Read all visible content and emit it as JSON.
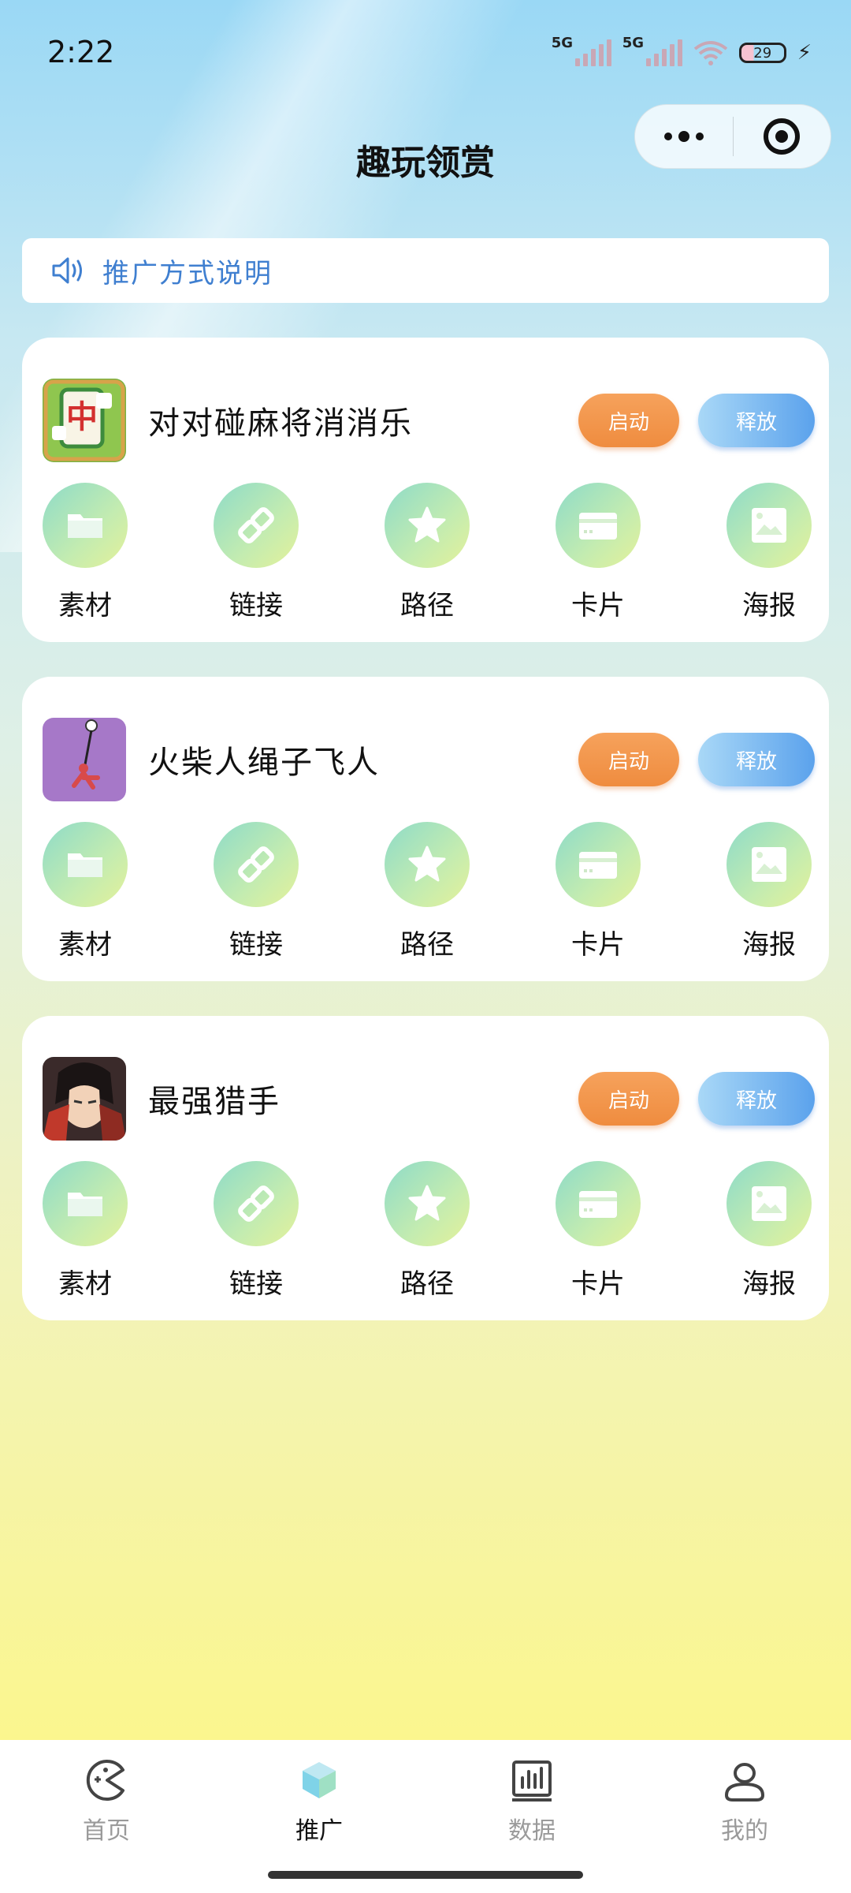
{
  "status_bar": {
    "time": "2:22",
    "signal1_label": "5G",
    "signal2_label": "5G",
    "battery": "29"
  },
  "header": {
    "title": "趣玩领赏"
  },
  "notice": {
    "text": "推广方式说明",
    "icon": "speaker-icon"
  },
  "cards": [
    {
      "name": "对对碰麻将消消乐",
      "start_label": "启动",
      "release_label": "释放",
      "actions": [
        "素材",
        "链接",
        "路径",
        "卡片",
        "海报"
      ]
    },
    {
      "name": "火柴人绳子飞人",
      "start_label": "启动",
      "release_label": "释放",
      "actions": [
        "素材",
        "链接",
        "路径",
        "卡片",
        "海报"
      ]
    },
    {
      "name": "最强猎手",
      "start_label": "启动",
      "release_label": "释放",
      "actions": [
        "素材",
        "链接",
        "路径",
        "卡片",
        "海报"
      ]
    }
  ],
  "tabbar": {
    "items": [
      {
        "label": "首页",
        "icon": "pacman-icon",
        "active": false
      },
      {
        "label": "推广",
        "icon": "cube-icon",
        "active": true
      },
      {
        "label": "数据",
        "icon": "bar-chart-icon",
        "active": false
      },
      {
        "label": "我的",
        "icon": "user-icon",
        "active": false
      }
    ]
  },
  "colors": {
    "accent_blue": "#3f7fd0",
    "start_orange": "#ef8c3f",
    "release_blue": "#5ba2ec"
  }
}
